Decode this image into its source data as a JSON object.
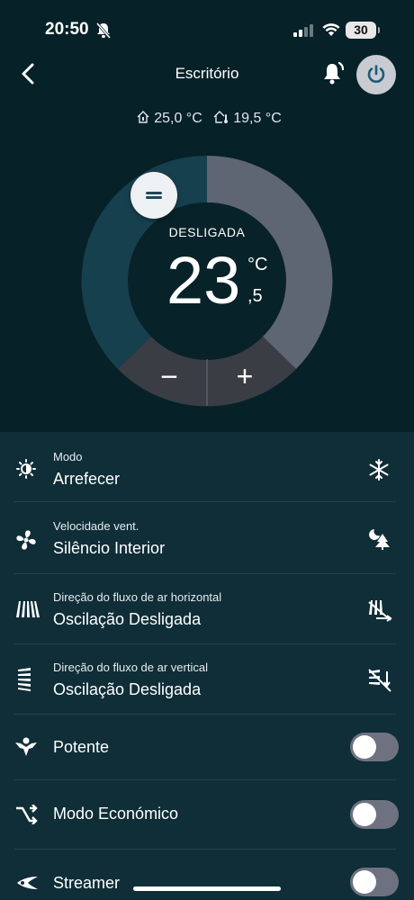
{
  "status_bar": {
    "time": "20:50",
    "battery": "30"
  },
  "header": {
    "title": "Escritório"
  },
  "temperatures": {
    "indoor": "25,0 °C",
    "outdoor": "19,5 °C"
  },
  "dial": {
    "state": "DESLIGADA",
    "setpoint_int": "23",
    "setpoint_dec": ",5",
    "unit": "°C",
    "minus": "−",
    "plus": "+"
  },
  "settings": {
    "mode": {
      "label": "Modo",
      "value": "Arrefecer",
      "icon": "mode-icon",
      "right_icon": "snowflake-icon"
    },
    "fan": {
      "label": "Velocidade vent.",
      "value": "Silêncio Interior",
      "icon": "fan-icon",
      "right_icon": "quiet-tree-icon"
    },
    "h_airflow": {
      "label": "Direção do fluxo de ar horizontal",
      "value": "Oscilação Desligada",
      "icon": "horizontal-flow-icon",
      "right_icon": "swing-off-icon"
    },
    "v_airflow": {
      "label": "Direção do fluxo de ar vertical",
      "value": "Oscilação Desligada",
      "icon": "vertical-flow-icon",
      "right_icon": "swing-off-icon"
    }
  },
  "toggles": [
    {
      "label": "Potente",
      "on": false,
      "icon": "powerful-icon"
    },
    {
      "label": "Modo Económico",
      "on": false,
      "icon": "econo-icon"
    },
    {
      "label": "Streamer",
      "on": false,
      "icon": "streamer-icon"
    }
  ],
  "colors": {
    "top_bg": "#072129",
    "list_bg": "#0f2e38",
    "dial_grey": "#5e6673",
    "dial_teal": "#17404e",
    "toggle_off": "#6e7280"
  }
}
